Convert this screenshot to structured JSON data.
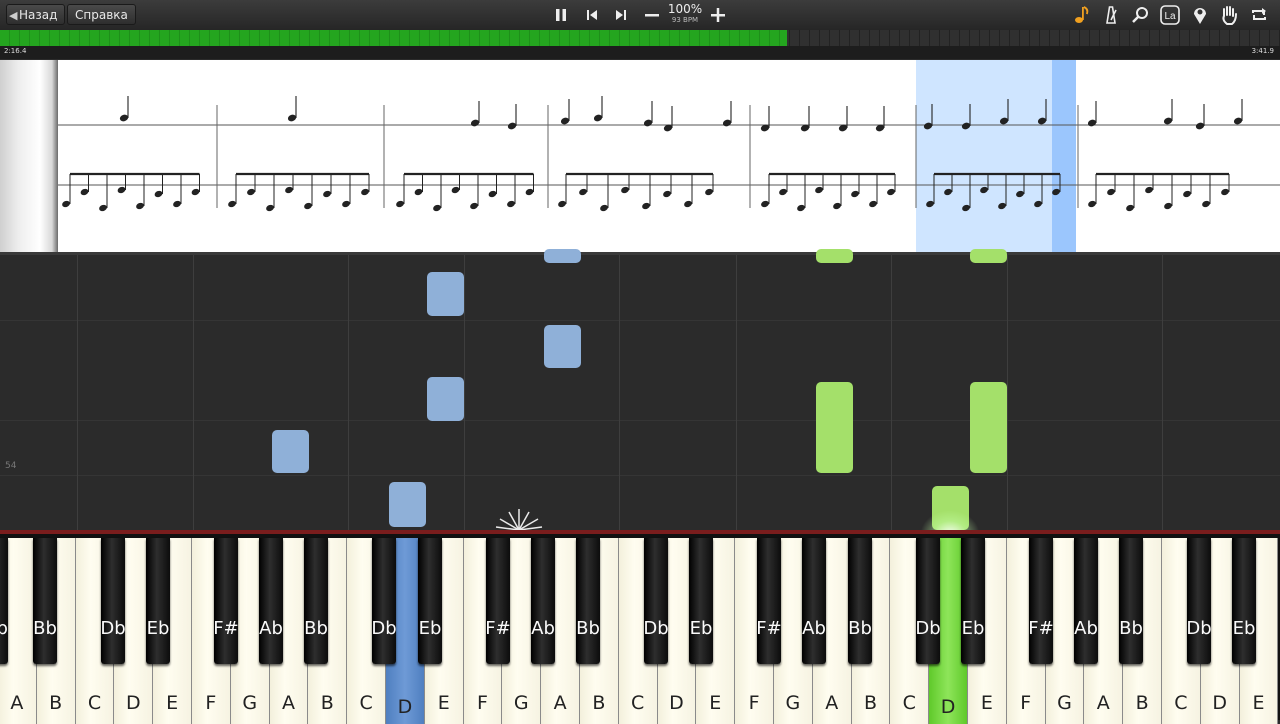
{
  "toolbar": {
    "back_label": "Назад",
    "help_label": "Справка",
    "speed_percent": "100%",
    "speed_bpm": "93 BPM"
  },
  "progress": {
    "elapsed": "2:16.4",
    "total": "3:41.9",
    "fraction": 0.615,
    "color": "#24a51f"
  },
  "roll": {
    "measure_number": "54",
    "left_hand_color": "#8fb0d8",
    "right_hand_color": "#a4e06a"
  },
  "keyboard": {
    "white_keys": [
      "A",
      "B",
      "C",
      "D",
      "E",
      "F",
      "G",
      "A",
      "B",
      "C",
      "D",
      "E",
      "F",
      "G",
      "A",
      "B",
      "C",
      "D",
      "E",
      "F",
      "G",
      "A",
      "B",
      "C",
      "D",
      "E",
      "F",
      "G",
      "A",
      "B",
      "C",
      "D",
      "E"
    ],
    "black_keys": [
      "Bb",
      "Bb",
      "Db",
      "Eb",
      "F#",
      "Ab",
      "Bb",
      "Db",
      "Eb",
      "F#",
      "Ab",
      "Bb",
      "Db",
      "Eb",
      "F#",
      "Ab",
      "Bb",
      "Db",
      "Eb",
      "F#",
      "Ab",
      "Bb",
      "Db",
      "Eb"
    ],
    "pressed_left": "D",
    "pressed_right": "D"
  },
  "icons": [
    "note-icon",
    "metronome-icon",
    "search-icon",
    "la-icon",
    "marker-icon",
    "hand-icon",
    "loop-icon"
  ]
}
